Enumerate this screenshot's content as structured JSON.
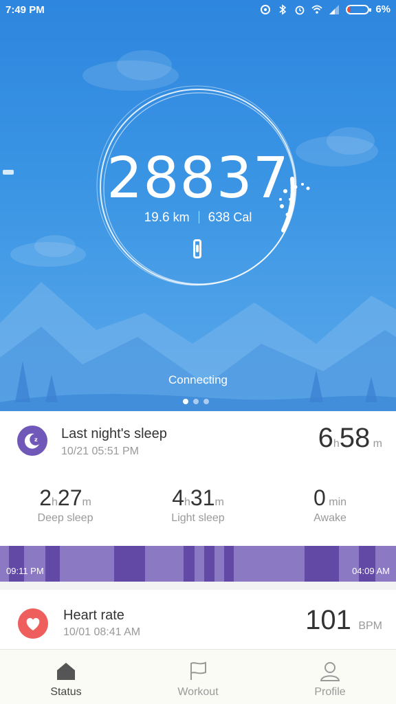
{
  "status_bar": {
    "time": "7:49 PM",
    "battery_percent": "6%"
  },
  "activity": {
    "steps": "28837",
    "distance_value": "19.6",
    "distance_unit": "km",
    "calories_value": "638",
    "calories_unit": "Cal",
    "connection_status": "Connecting",
    "page_indicator": {
      "count": 3,
      "active": 1
    }
  },
  "sleep": {
    "title": "Last night's sleep",
    "date": "10/21 05:51 PM",
    "total": {
      "hours": "6",
      "hours_unit": "h",
      "minutes": "58",
      "minutes_unit": "m"
    },
    "stats": [
      {
        "hours": "2",
        "hours_unit": "h",
        "minutes": "27",
        "minutes_unit": "m",
        "label": "Deep sleep"
      },
      {
        "hours": "4",
        "hours_unit": "h",
        "minutes": "31",
        "minutes_unit": "m",
        "label": "Light sleep"
      },
      {
        "value": "0",
        "unit": "min",
        "label": "Awake"
      }
    ],
    "start_time": "09:11 PM",
    "end_time": "04:09 AM",
    "colors": {
      "light": "#8b79c4",
      "deep": "#6249a6",
      "icon": "#6f58b8"
    }
  },
  "heart_rate": {
    "title": "Heart rate",
    "date": "10/01 08:41 AM",
    "value": "101",
    "unit": "BPM",
    "color": "#ee5e5c"
  },
  "tabs": [
    {
      "label": "Status",
      "icon": "home-icon",
      "active": true
    },
    {
      "label": "Workout",
      "icon": "flag-icon",
      "active": false
    },
    {
      "label": "Profile",
      "icon": "person-icon",
      "active": false
    }
  ]
}
